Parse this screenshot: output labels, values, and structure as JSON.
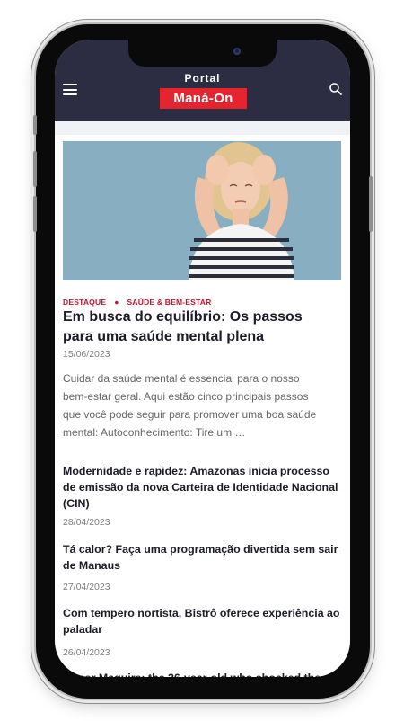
{
  "brand": {
    "top": "Portal",
    "logo": "Maná-On",
    "colors": {
      "header_bg": "#2c2d42",
      "logo_bg": "#e4252f",
      "category": "#c8102e"
    }
  },
  "header": {
    "menu_icon": "hamburger-menu-icon",
    "search_icon": "search-icon"
  },
  "featured": {
    "categories": [
      "DESTAQUE",
      "SAÚDE & BEM-ESTAR"
    ],
    "title": "Em busca do equilíbrio: Os passos para uma saúde mental plena",
    "date": "15/06/2023",
    "excerpt": "Cuidar da saúde mental é essencial para o nosso bem-estar geral. Aqui estão cinco principais passos que você pode seguir para promover uma boa saúde mental: Autoconhecimento: Tire um …"
  },
  "articles": [
    {
      "title": "Modernidade e rapidez: Amazonas inicia processo de emissão da nova Carteira de Identidade Nacional (CIN)",
      "date": "28/04/2023"
    },
    {
      "title": "Tá calor? Faça uma programação divertida sem sair de Manaus",
      "date": "27/04/2023"
    },
    {
      "title": "Com tempero nortista, Bistrô oferece experiência ao paladar",
      "date": "26/04/2023"
    },
    {
      "title": "Conor Maguire: the 26-year-old who shocked the",
      "date": ""
    }
  ]
}
